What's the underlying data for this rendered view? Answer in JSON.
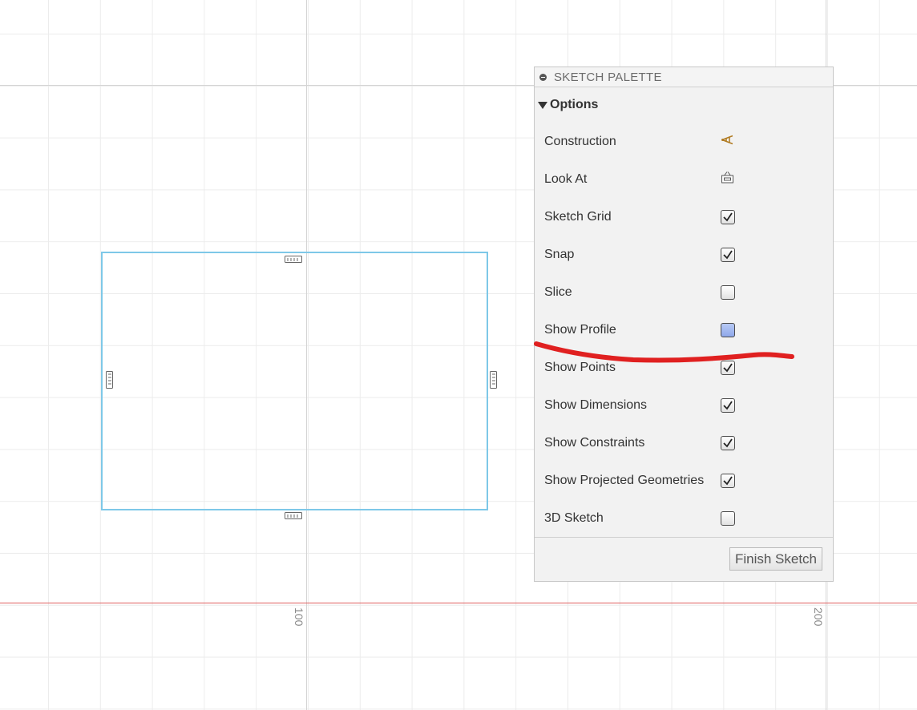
{
  "palette": {
    "title": "SKETCH PALETTE",
    "section": "Options",
    "options": [
      {
        "label": "Construction",
        "control": "construction-icon"
      },
      {
        "label": "Look At",
        "control": "look-at-icon"
      },
      {
        "label": "Sketch Grid",
        "control": "checkbox",
        "checked": true
      },
      {
        "label": "Snap",
        "control": "checkbox",
        "checked": true
      },
      {
        "label": "Slice",
        "control": "checkbox",
        "checked": false
      },
      {
        "label": "Show Profile",
        "control": "checkbox",
        "checked": false,
        "highlighted": true
      },
      {
        "label": "Show Points",
        "control": "checkbox",
        "checked": true
      },
      {
        "label": "Show Dimensions",
        "control": "checkbox",
        "checked": true
      },
      {
        "label": "Show Constraints",
        "control": "checkbox",
        "checked": true
      },
      {
        "label": "Show Projected Geometries",
        "control": "checkbox",
        "checked": true
      },
      {
        "label": "3D Sketch",
        "control": "checkbox",
        "checked": false
      }
    ],
    "finish_label": "Finish Sketch"
  },
  "canvas": {
    "axis_labels": [
      "100",
      "200"
    ]
  },
  "colors": {
    "sketch_line": "#7ec8e8",
    "x_axis": "#e06060",
    "annotation": "#e02020",
    "checkbox_highlight": "#a3b8f0"
  }
}
